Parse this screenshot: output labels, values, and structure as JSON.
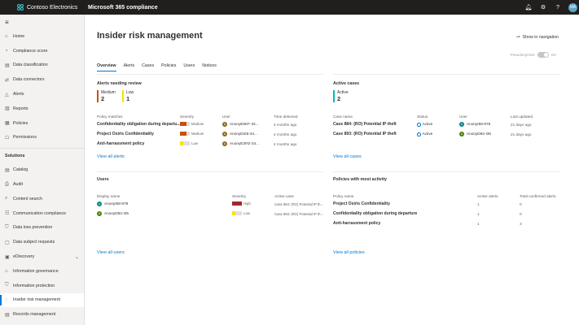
{
  "topbar": {
    "org": "Contoso Electronics",
    "app": "Microsoft 365 compliance",
    "icons": [
      "bell-icon",
      "gear-icon",
      "help-icon"
    ],
    "avatar_initials": "MA"
  },
  "sidebar": {
    "hamburger_icon": "hamburger-icon",
    "items": [
      {
        "label": "Home",
        "icon": "⌂"
      },
      {
        "label": "Compliance score",
        "icon": "◔"
      },
      {
        "label": "Data classification",
        "icon": "▤"
      },
      {
        "label": "Data connectors",
        "icon": "⇄"
      },
      {
        "label": "Alerts",
        "icon": "△"
      },
      {
        "label": "Reports",
        "icon": "▥"
      },
      {
        "label": "Policies",
        "icon": "▦"
      },
      {
        "label": "Permissions",
        "icon": "☖"
      }
    ],
    "section_label": "Solutions",
    "solutions": [
      {
        "label": "Catalog",
        "icon": "▤"
      },
      {
        "label": "Audit",
        "icon": "⎙"
      },
      {
        "label": "Content search",
        "icon": "⌕"
      },
      {
        "label": "Communication compliance",
        "icon": "☷"
      },
      {
        "label": "Data loss prevention",
        "icon": "⛉"
      },
      {
        "label": "Data subject requests",
        "icon": "▢"
      },
      {
        "label": "eDiscovery",
        "icon": "▣",
        "chevron": "⌄"
      },
      {
        "label": "Information governance",
        "icon": "⌂"
      },
      {
        "label": "Information protection",
        "icon": "⛉"
      },
      {
        "label": "Insider risk management",
        "icon": "◌"
      },
      {
        "label": "Records management",
        "icon": "▤"
      }
    ]
  },
  "main": {
    "title": "Insider risk management",
    "show_nav": "Show in navigation",
    "pseudonymize_label": "Pseudonymize",
    "pseudonymize_state": "On",
    "tabs": [
      "Overview",
      "Alerts",
      "Cases",
      "Policies",
      "Users",
      "Notices"
    ],
    "alerts_card": {
      "title": "Alerts needing review",
      "metrics": [
        {
          "label": "Medium",
          "value": "2",
          "color": "#ca5010"
        },
        {
          "label": "Low",
          "value": "1",
          "color": "#fce100"
        }
      ],
      "headers": [
        "Policy matches",
        "Severity",
        "User",
        "Time detected"
      ],
      "rows": [
        {
          "policy": "Confidentiality obligation during departu...",
          "severity": "Medium",
          "user": "AnonyE5KF-34...",
          "avatar": "A",
          "avatar_color": "#8a6a1f",
          "time": "4 months ago"
        },
        {
          "policy": "Project Osiris Confidentiality",
          "severity": "Medium",
          "user": "AnonyD4I5-34...",
          "avatar": "A",
          "avatar_color": "#8a6a1f",
          "time": "4 months ago"
        },
        {
          "policy": "Anti-harrassment policy",
          "severity": "Low",
          "user": "AnonyE3FD-34...",
          "avatar": "A",
          "avatar_color": "#8a6a1f",
          "time": "4 months ago"
        }
      ],
      "link": "View all alerts"
    },
    "cases_card": {
      "title": "Active cases",
      "metric": {
        "label": "Active",
        "value": "2",
        "color": "#00b7c3"
      },
      "headers": [
        "Case name",
        "Status",
        "User",
        "Last updated"
      ],
      "rows": [
        {
          "case": "Case 884: (RO) Potential IP theft",
          "status": "Active",
          "user": "AnonyI58-978",
          "avatar": "A",
          "avatar_color": "#038387",
          "updated": "21 days ago"
        },
        {
          "case": "Case 893: (RO) Potential IP theft",
          "status": "Active",
          "user": "AnonyD84-I35",
          "avatar": "A",
          "avatar_color": "#498205",
          "updated": "21 days ago"
        }
      ],
      "link": "View all cases"
    },
    "users_card": {
      "title": "Users",
      "headers": [
        "Display name",
        "Severity",
        "Active case"
      ],
      "rows": [
        {
          "name": "AnonyI58-978",
          "avatar": "A",
          "avatar_color": "#038387",
          "severity": "High",
          "case": "Case 884: (RO) Potential IP th..."
        },
        {
          "name": "AnonyD84-I35",
          "avatar": "A",
          "avatar_color": "#498205",
          "severity": "Low",
          "case": "Case 893: (RO) Potential IP th..."
        }
      ],
      "link": "View all users"
    },
    "policies_card": {
      "title": "Policies with most activity",
      "headers": [
        "Policy name",
        "Active alerts",
        "Total confirmed alerts"
      ],
      "rows": [
        {
          "name": "Project Osiris Confidentiality",
          "active": "1",
          "total": "0"
        },
        {
          "name": "Confidentiality obligation during departure",
          "active": "1",
          "total": "0"
        },
        {
          "name": "Anti-harrassment policy",
          "active": "1",
          "total": "3"
        }
      ],
      "link": "View all policies"
    }
  },
  "colors": {
    "accent": "#0078d4",
    "sev_high": "#a4262c",
    "sev_medium": "#ca5010",
    "sev_low": "#fce100",
    "sev_empty": "#e1dfdd"
  }
}
